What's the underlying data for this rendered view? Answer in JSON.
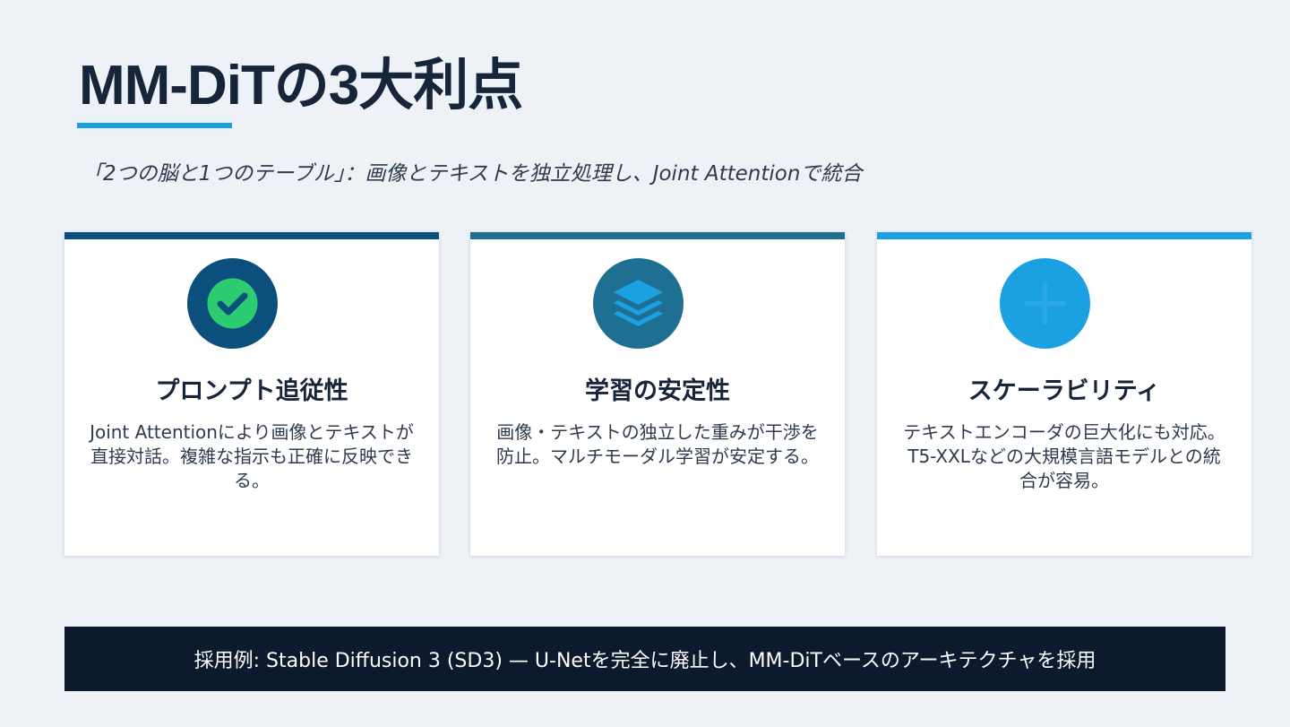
{
  "slide": {
    "title": "MM-DiTの3大利点",
    "subtitle": "「2つの脳と1つのテーブル」：画像とテキストを独立処理し、Joint Attentionで統合"
  },
  "cards": [
    {
      "title": "プロンプト追従性",
      "body": "Joint Attentionにより画像とテキストが直接対話。複雑な指示も正確に反映できる。",
      "icon": "check-circle-icon",
      "accent": "#0b4f7c",
      "icon_bg": "#0b4f7c",
      "icon_fg": "#2ecc71"
    },
    {
      "title": "学習の安定性",
      "body": "画像・テキストの独立した重みが干渉を防止。マルチモーダル学習が安定する。",
      "icon": "layers-icon",
      "accent": "#1f6f93",
      "icon_bg": "#1f6f93",
      "icon_fg": "#1ba1e2"
    },
    {
      "title": "スケーラビリティ",
      "body": "テキストエンコーダの巨大化にも対応。T5-XXLなどの大規模言語モデルとの統合が容易。",
      "icon": "expand-icon",
      "accent": "#1ba1e2",
      "icon_bg": "#1ba1e2",
      "icon_fg": "#1ba1e2"
    }
  ],
  "banner": {
    "text": "採用例: Stable Diffusion 3 (SD3) — U-Netを完全に廃止し、MM-DiTベースのアーキテクチャを採用"
  }
}
